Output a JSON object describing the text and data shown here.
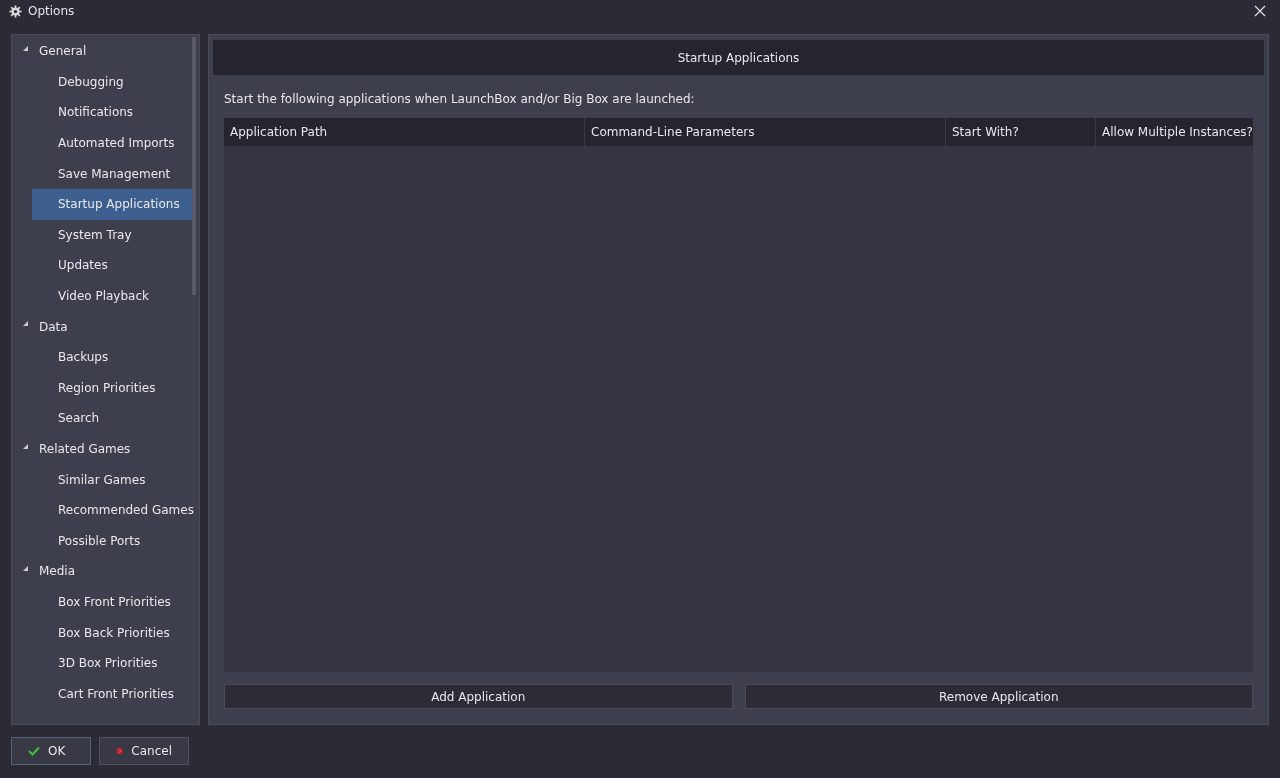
{
  "window": {
    "title": "Options"
  },
  "sidebar": {
    "items": [
      {
        "label": "General",
        "expanded": true,
        "selected": false,
        "children": [
          {
            "label": "Debugging",
            "selected": false
          },
          {
            "label": "Notifications",
            "selected": false
          },
          {
            "label": "Automated Imports",
            "selected": false
          },
          {
            "label": "Save Management",
            "selected": false
          },
          {
            "label": "Startup Applications",
            "selected": true
          },
          {
            "label": "System Tray",
            "selected": false
          },
          {
            "label": "Updates",
            "selected": false
          },
          {
            "label": "Video Playback",
            "selected": false
          }
        ]
      },
      {
        "label": "Data",
        "expanded": true,
        "selected": false,
        "children": [
          {
            "label": "Backups",
            "selected": false
          },
          {
            "label": "Region Priorities",
            "selected": false
          },
          {
            "label": "Search",
            "selected": false
          }
        ]
      },
      {
        "label": "Related Games",
        "expanded": true,
        "selected": false,
        "children": [
          {
            "label": "Similar Games",
            "selected": false
          },
          {
            "label": "Recommended Games",
            "selected": false
          },
          {
            "label": "Possible Ports",
            "selected": false
          }
        ]
      },
      {
        "label": "Media",
        "expanded": true,
        "selected": false,
        "children": [
          {
            "label": "Box Front Priorities",
            "selected": false
          },
          {
            "label": "Box Back Priorities",
            "selected": false
          },
          {
            "label": "3D Box Priorities",
            "selected": false
          },
          {
            "label": "Cart Front Priorities",
            "selected": false
          }
        ]
      }
    ]
  },
  "panel": {
    "title": "Startup Applications",
    "description": "Start the following applications when LaunchBox and/or Big Box are launched:",
    "table": {
      "columns": [
        "Application Path",
        "Command-Line Parameters",
        "Start With?",
        "Allow Multiple Instances?"
      ]
    },
    "buttons": [
      "Add Application",
      "Remove Application"
    ]
  },
  "footer": {
    "buttons": [
      {
        "kind": "ok",
        "label": "OK"
      },
      {
        "kind": "cancel",
        "label": "Cancel"
      }
    ]
  }
}
